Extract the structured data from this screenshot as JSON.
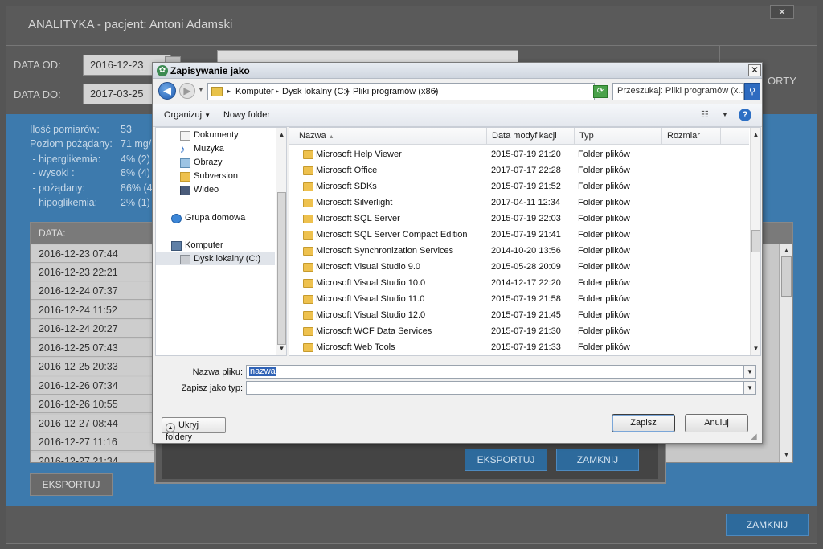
{
  "app": {
    "title": "ANALITYKA - pacjent: Antoni Adamski",
    "close_label": "✕",
    "date_from_label": "DATA OD:",
    "date_from_value": "2016-12-23",
    "date_to_label": "DATA DO:",
    "date_to_value": "2017-03-25",
    "right_label": "ORTY",
    "stats": [
      {
        "label": "Ilość pomiarów:",
        "value": "53"
      },
      {
        "label": "Poziom pożądany:",
        "value": "71 mg/"
      },
      {
        "label": " - hiperglikemia:",
        "value": "4% (2)"
      },
      {
        "label": " - wysoki :",
        "value": "8% (4)"
      },
      {
        "label": " - pożądany:",
        "value": "86% (4"
      },
      {
        "label": " - hipoglikemia:",
        "value": "2% (1)"
      }
    ],
    "table_header": "DATA:",
    "dates": [
      "2016-12-23 07:44",
      "2016-12-23 22:21",
      "2016-12-24 07:37",
      "2016-12-24 11:52",
      "2016-12-24 20:27",
      "2016-12-25 07:43",
      "2016-12-25 20:33",
      "2016-12-26 07:34",
      "2016-12-26 10:55",
      "2016-12-27 08:44",
      "2016-12-27 11:16",
      "2016-12-27 21:34"
    ],
    "export_button": "EKSPORTUJ",
    "close_button": "ZAMKNIJ"
  },
  "export_dialog": {
    "export_button": "EKSPORTUJ",
    "close_button": "ZAMKNIJ"
  },
  "save_dialog": {
    "title": "Zapisywanie jako",
    "close_label": "✕",
    "breadcrumbs": [
      "Komputer",
      "Dysk lokalny (C:)",
      "Pliki programów (x86)"
    ],
    "search_placeholder": "Przeszukaj: Pliki programów (x...",
    "toolbar": {
      "organize": "Organizuj",
      "new_folder": "Nowy folder"
    },
    "nav_items": [
      {
        "label": "Dokumenty",
        "icon": "documents-icon"
      },
      {
        "label": "Muzyka",
        "icon": "music-icon"
      },
      {
        "label": "Obrazy",
        "icon": "pictures-icon"
      },
      {
        "label": "Subversion",
        "icon": "subversion-icon"
      },
      {
        "label": "Wideo",
        "icon": "video-icon"
      },
      {
        "label": "Grupa domowa",
        "icon": "homegroup-icon"
      },
      {
        "label": "Komputer",
        "icon": "computer-icon"
      },
      {
        "label": "Dysk lokalny (C:)",
        "icon": "drive-icon"
      }
    ],
    "columns": [
      "Nazwa",
      "Data modyfikacji",
      "Typ",
      "Rozmiar"
    ],
    "files": [
      {
        "name": "Microsoft Help Viewer",
        "date": "2015-07-19 21:20",
        "type": "Folder plików"
      },
      {
        "name": "Microsoft Office",
        "date": "2017-07-17 22:28",
        "type": "Folder plików"
      },
      {
        "name": "Microsoft SDKs",
        "date": "2015-07-19 21:52",
        "type": "Folder plików"
      },
      {
        "name": "Microsoft Silverlight",
        "date": "2017-04-11 12:34",
        "type": "Folder plików"
      },
      {
        "name": "Microsoft SQL Server",
        "date": "2015-07-19 22:03",
        "type": "Folder plików"
      },
      {
        "name": "Microsoft SQL Server Compact Edition",
        "date": "2015-07-19 21:41",
        "type": "Folder plików"
      },
      {
        "name": "Microsoft Synchronization Services",
        "date": "2014-10-20 13:56",
        "type": "Folder plików"
      },
      {
        "name": "Microsoft Visual Studio 9.0",
        "date": "2015-05-28 20:09",
        "type": "Folder plików"
      },
      {
        "name": "Microsoft Visual Studio 10.0",
        "date": "2014-12-17 22:20",
        "type": "Folder plików"
      },
      {
        "name": "Microsoft Visual Studio 11.0",
        "date": "2015-07-19 21:58",
        "type": "Folder plików"
      },
      {
        "name": "Microsoft Visual Studio 12.0",
        "date": "2015-07-19 21:45",
        "type": "Folder plików"
      },
      {
        "name": "Microsoft WCF Data Services",
        "date": "2015-07-19 21:30",
        "type": "Folder plików"
      },
      {
        "name": "Microsoft Web Tools",
        "date": "2015-07-19 21:33",
        "type": "Folder plików"
      }
    ],
    "filename_label": "Nazwa pliku:",
    "filename_value": "nazwa",
    "filetype_label": "Zapisz jako typ:",
    "filetype_value": "",
    "hide_folders": "Ukryj foldery",
    "save_button": "Zapisz",
    "cancel_button": "Anuluj"
  }
}
